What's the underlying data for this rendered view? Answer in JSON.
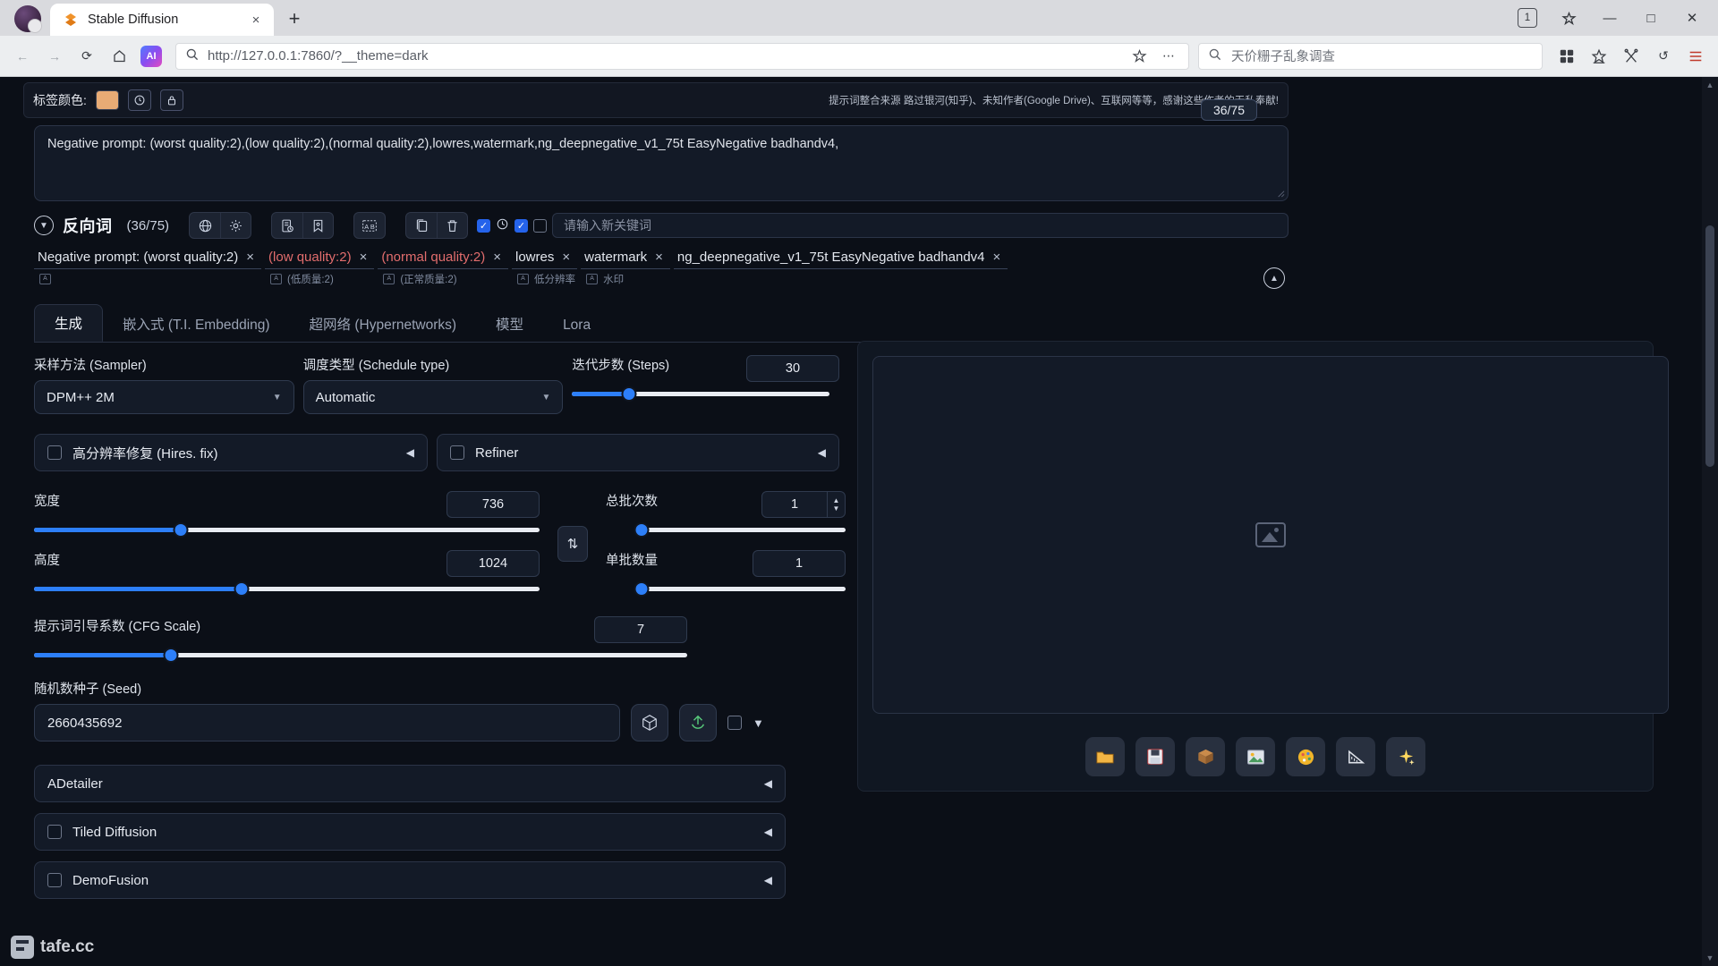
{
  "browser": {
    "tab": {
      "title": "Stable Diffusion",
      "favicon": "stable-diffusion-icon",
      "close": "×"
    },
    "newtab_label": "+",
    "window_controls": {
      "badge": "1",
      "minimize": "—",
      "maximize": "□",
      "close": "✕"
    },
    "nav": {
      "back": "←",
      "forward": "→",
      "reload": "⟳",
      "home": "⌂",
      "ai_badge": "AI",
      "url_prefix": "http://",
      "url_host": "127.0.0.1:7860",
      "url_suffix": "/?__theme=dark",
      "url_full": "http://127.0.0.1:7860/?__theme=dark",
      "bookmark": "☆",
      "more": "⋯",
      "search_placeholder": "天价粣子乱象调查",
      "collections": "▦",
      "favorites": "☆",
      "split": "✂",
      "history": "↺",
      "menu": "☰"
    }
  },
  "taglib": {
    "label": "标签颜色:",
    "swatch_color": "#e8ab75",
    "reset_icon": "reset-icon",
    "lock_icon": "lock-icon",
    "credit": "提示词整合来源 路过银河(知乎)、未知作者(Google Drive)、互联网等等，感谢这些作者的无私奉献!"
  },
  "negative_prompt": {
    "text": "Negative prompt: (worst quality:2),(low quality:2),(normal quality:2),lowres,watermark,ng_deepnegative_v1_75t EasyNegative badhandv4,",
    "token_counter": "36/75"
  },
  "reverse_word": {
    "title": "反向词",
    "count": "(36/75)",
    "icons": [
      "globe-icon",
      "gear-icon",
      "list-clock-icon",
      "bookmark-icon",
      "translate-icon",
      "copy-icon",
      "trash-icon"
    ],
    "keyword_placeholder": "请输入新关键词",
    "checkbox1": true,
    "clock_icon": "clock-icon",
    "checkbox2": true,
    "checkbox3": false,
    "collapse_icon": "collapse-up-icon"
  },
  "chips": [
    {
      "text": "Negative prompt: (worst quality:2)",
      "red": false,
      "sub": ""
    },
    {
      "text": "(low quality:2)",
      "red": true,
      "sub": "(低质量:2)"
    },
    {
      "text": "(normal quality:2)",
      "red": true,
      "sub": "(正常质量:2)"
    },
    {
      "text": "lowres",
      "red": false,
      "sub": "低分辨率"
    },
    {
      "text": "watermark",
      "red": false,
      "sub": "水印"
    },
    {
      "text": "ng_deepnegative_v1_75t EasyNegative badhandv4",
      "red": false,
      "sub": ""
    }
  ],
  "tabs": [
    {
      "label": "生成",
      "active": true
    },
    {
      "label": "嵌入式 (T.I. Embedding)",
      "active": false
    },
    {
      "label": "超网络 (Hypernetworks)",
      "active": false
    },
    {
      "label": "模型",
      "active": false
    },
    {
      "label": "Lora",
      "active": false
    }
  ],
  "generation": {
    "sampler_label": "采样方法 (Sampler)",
    "sampler_value": "DPM++ 2M",
    "schedule_label": "调度类型 (Schedule type)",
    "schedule_value": "Automatic",
    "steps_label": "迭代步数 (Steps)",
    "steps_value": "30",
    "steps_pct": 22,
    "hires_label": "高分辨率修复 (Hires. fix)",
    "refiner_label": "Refiner",
    "width_label": "宽度",
    "width_value": "736",
    "width_pct": 35,
    "height_label": "高度",
    "height_value": "1024",
    "height_pct": 49,
    "cfg_label": "提示词引导系数 (CFG Scale)",
    "cfg_value": "7",
    "cfg_pct": 21,
    "batch_count_label": "总批次数",
    "batch_count_value": "1",
    "batch_count_pct": 1,
    "batch_size_label": "单批数量",
    "batch_size_value": "1",
    "batch_size_pct": 1,
    "seed_label": "随机数种子 (Seed)",
    "seed_value": "2660435692",
    "swap_icon": "swap-icon",
    "dice_icon": "dice-icon",
    "recycle_icon": "recycle-icon",
    "extra_caret": "▼"
  },
  "accordions": [
    {
      "label": "ADetailer",
      "checkbox": false,
      "has_checkbox": false
    },
    {
      "label": "Tiled Diffusion",
      "checkbox": false,
      "has_checkbox": true
    },
    {
      "label": "DemoFusion",
      "checkbox": false,
      "has_checkbox": true
    }
  ],
  "preview": {
    "placeholder_icon": "image-placeholder-icon",
    "tools": [
      {
        "name": "folder-icon",
        "glyph": "📁"
      },
      {
        "name": "save-icon",
        "glyph": "💾"
      },
      {
        "name": "archive-icon",
        "glyph": "📦"
      },
      {
        "name": "image-icon",
        "glyph": "🖼"
      },
      {
        "name": "palette-icon",
        "glyph": "🎨"
      },
      {
        "name": "ruler-icon",
        "glyph": "📐"
      },
      {
        "name": "sparkle-icon",
        "glyph": "✨"
      }
    ]
  },
  "watermark": {
    "text": "tafe.cc"
  }
}
